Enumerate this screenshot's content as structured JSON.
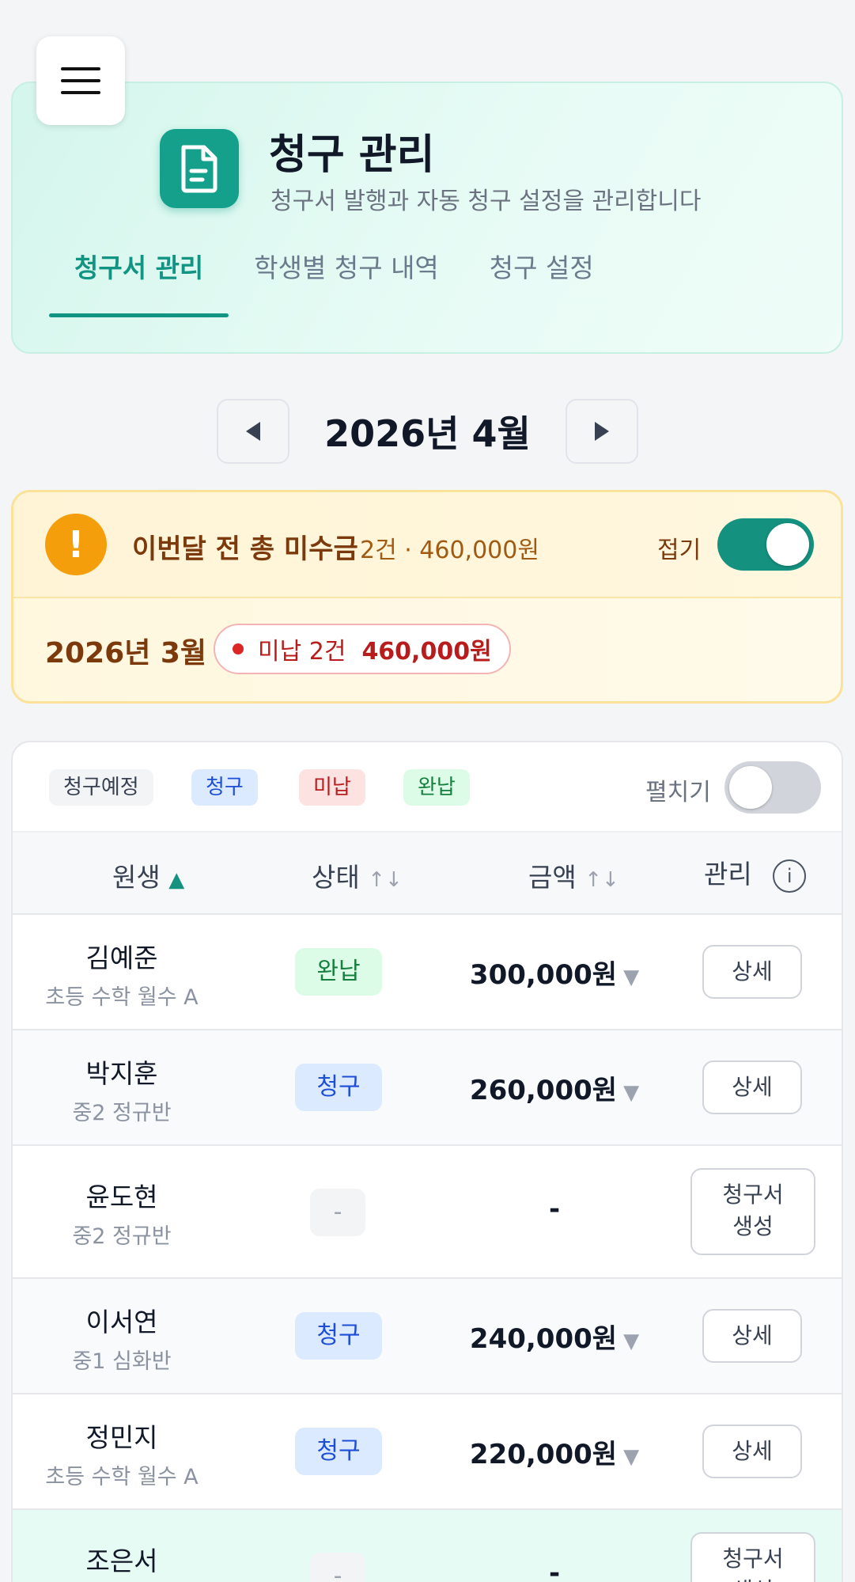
{
  "header": {
    "title": "청구 관리",
    "subtitle": "청구서 발행과 자동 청구 설정을 관리합니다",
    "tabs": [
      "청구서 관리",
      "학생별 청구 내역",
      "청구 설정"
    ]
  },
  "month_nav": {
    "label": "2026년 4월"
  },
  "alert": {
    "title": "이번달 전 총 미수금",
    "summary": "2건 · 460,000원",
    "fold_label": "접기",
    "fold_toggle_on": true,
    "month": "2026년 3월",
    "unpaid_count": "미납 2건",
    "unpaid_amount": "460,000원"
  },
  "legend": {
    "items": [
      "청구예정",
      "청구",
      "미납",
      "완납"
    ],
    "expand_label": "펼치기",
    "expand_toggle_on": false
  },
  "table": {
    "headers": [
      "원생",
      "상태",
      "금액",
      "관리"
    ],
    "sort_up": "▲",
    "sort_arrows": "↑↓",
    "info": "i",
    "rows": [
      {
        "name": "김예준",
        "class": "초등 수학 월수 A",
        "status": "완납",
        "amount": "300,000원",
        "action": "상세"
      },
      {
        "name": "박지훈",
        "class": "중2 정규반",
        "status": "청구",
        "amount": "260,000원",
        "action": "상세"
      },
      {
        "name": "윤도현",
        "class": "중2 정규반",
        "status": "-",
        "amount": "-",
        "action": "청구서\n생성"
      },
      {
        "name": "이서연",
        "class": "중1 심화반",
        "status": "청구",
        "amount": "240,000원",
        "action": "상세"
      },
      {
        "name": "정민지",
        "class": "초등 수학 월수 A",
        "status": "청구",
        "amount": "220,000원",
        "action": "상세"
      },
      {
        "name": "조은서",
        "class": "",
        "status": "-",
        "amount": "-",
        "action": "청구서\n생성"
      }
    ],
    "caret": "▼"
  },
  "colors": {
    "accent": "#14917f",
    "paid": "#dcfce7",
    "billed": "#dbeafe",
    "unpaid": "#fde2e2",
    "warning": "#f59e0b"
  },
  "icons": [
    "menu-icon",
    "document-icon",
    "chevron-left-icon",
    "chevron-right-icon",
    "warning-icon",
    "info-icon"
  ]
}
